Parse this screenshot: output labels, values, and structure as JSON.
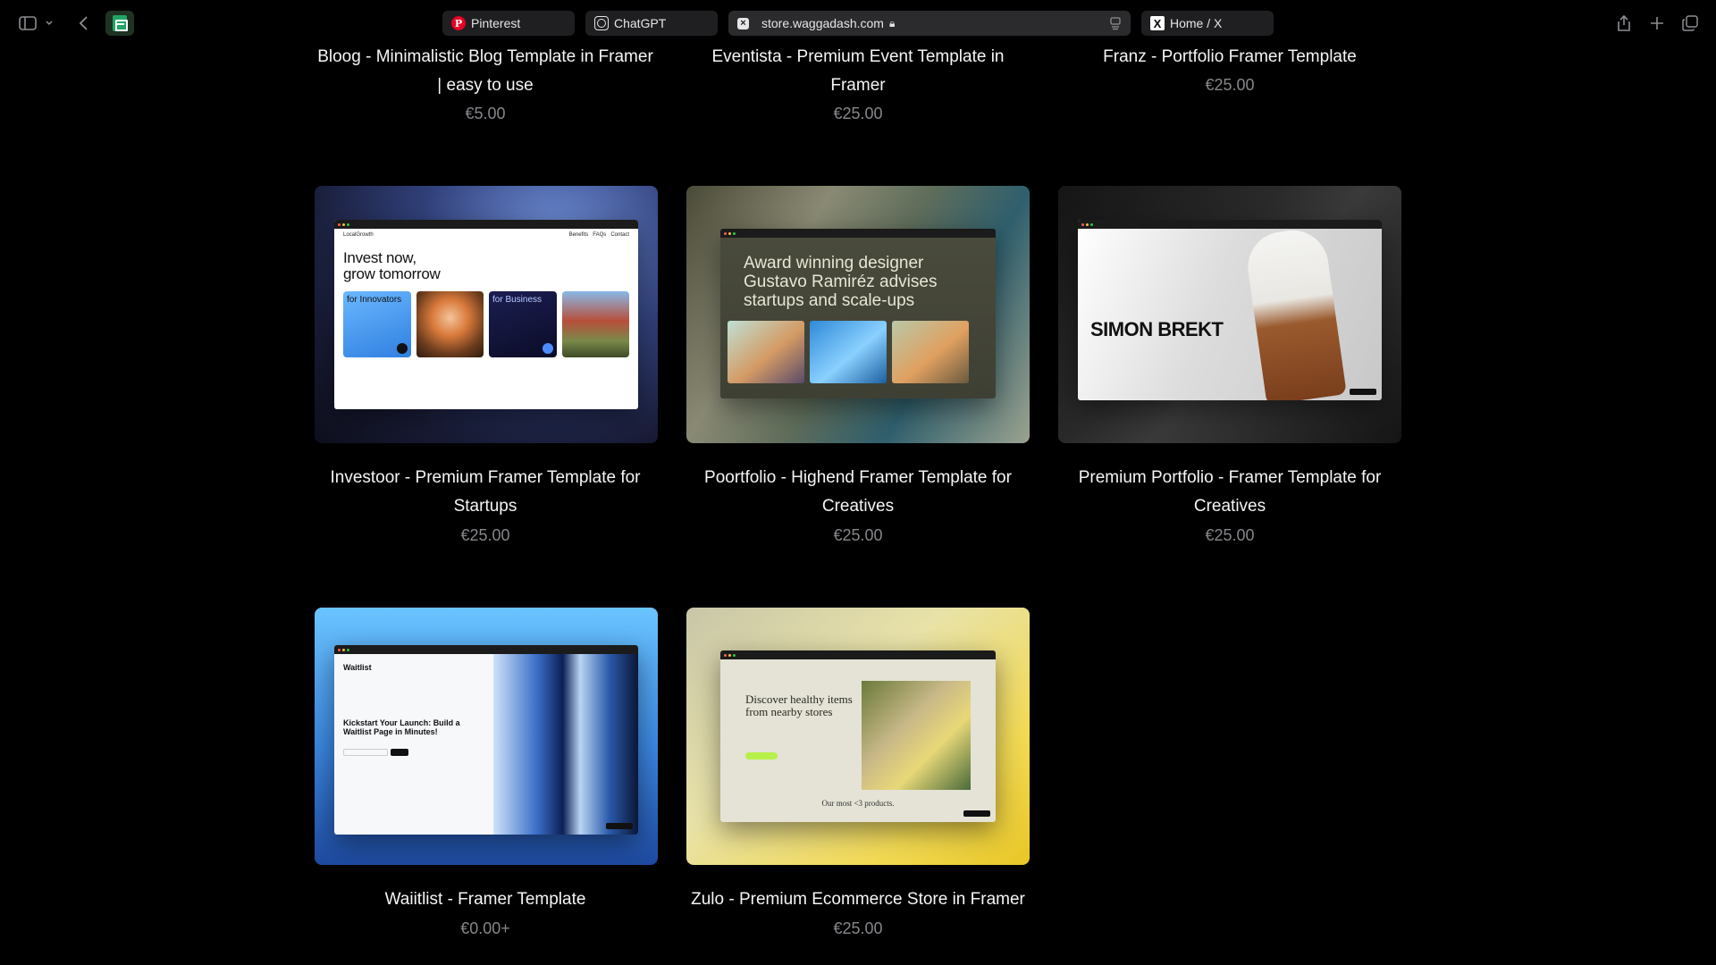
{
  "browser": {
    "tabs": [
      {
        "label": "Pinterest",
        "icon": "pinterest-icon"
      },
      {
        "label": "ChatGPT",
        "icon": "chatgpt-icon"
      },
      {
        "label": "store.waggadash.com",
        "icon": "store-favicon",
        "active": true
      },
      {
        "label": "Home / X",
        "icon": "x-icon"
      }
    ]
  },
  "top_row": [
    {
      "title_line1": "Bloog - Minimalistic Blog Template in Framer",
      "title_line2": "| easy to use",
      "price": "€5.00"
    },
    {
      "title_line1": "Eventista - Premium Event Template in",
      "title_line2": "Framer",
      "price": "€25.00"
    },
    {
      "title_line1": "Franz - Portfolio Framer Template",
      "title_line2": "",
      "price": "€25.00"
    }
  ],
  "products": [
    {
      "title_line1": "Investoor - Premium Framer Template for",
      "title_line2": "Startups",
      "price": "€25.00",
      "preview": {
        "brand": "LocalGrowth",
        "nav": [
          "Benefits",
          "FAQs",
          "Contact"
        ],
        "headline_1": "Invest now,",
        "headline_2": "grow tomorrow",
        "tile_1": "for Innovators",
        "tile_2": "for Business"
      }
    },
    {
      "title_line1": "Poortfolio - Highend Framer Template for",
      "title_line2": "Creatives",
      "price": "€25.00",
      "preview": {
        "headline_1": "Award winning designer",
        "headline_2": "Gustavo Ramiréz advises",
        "headline_3": "startups and scale-ups"
      }
    },
    {
      "title_line1": "Premium Portfolio - Framer Template for",
      "title_line2": "Creatives",
      "price": "€25.00",
      "preview": {
        "headline": "SIMON BREKT"
      }
    },
    {
      "title_line1": "Waiitlist - Framer Template",
      "title_line2": "",
      "price": "€0.00+",
      "preview": {
        "brand": "Waitlist",
        "headline": "Kickstart Your Launch: Build a Waitlist Page in Minutes!"
      }
    },
    {
      "title_line1": "Zulo - Premium Ecommerce Store in Framer",
      "title_line2": "",
      "price": "€25.00",
      "preview": {
        "headline": "Discover healthy items from nearby stores",
        "footer": "Our most <3 products."
      }
    }
  ]
}
